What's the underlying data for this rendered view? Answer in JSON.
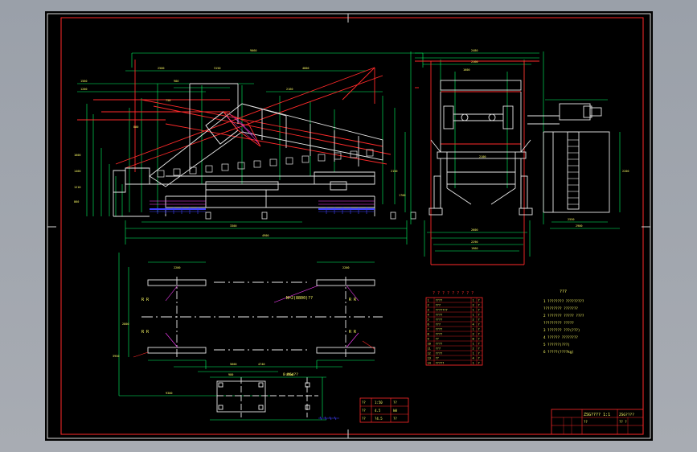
{
  "drawing": {
    "background": "#000000",
    "frame_color": "#e0e0e0",
    "border_color": "#ff2a2a",
    "dim_color": "#00ff66",
    "feature_color": "#ff2a2a",
    "aux_color": "#ff40ff",
    "hatch_color": "#4040ff",
    "text_color": "#ffff66"
  },
  "labels": {
    "plan_spacing_note": "N=2(8800)??",
    "bolt_note": "8-M64??",
    "corner_note_a": "R  R",
    "corner_note_b": "R  R",
    "corner_note_c": "R  R",
    "corner_note_d": "R  R"
  },
  "bom": {
    "header": "? ? ? ? ? ? ? ? ?",
    "rows": [
      [
        "1",
        "????",
        "1",
        "?"
      ],
      [
        "2",
        "???",
        "2",
        "?"
      ],
      [
        "3",
        "???????",
        "1",
        "?"
      ],
      [
        "4",
        "????",
        "1",
        "?"
      ],
      [
        "5",
        "????",
        "2",
        "?"
      ],
      [
        "6",
        "???",
        "4",
        "?"
      ],
      [
        "7",
        "????",
        "1",
        "?"
      ],
      [
        "8",
        "????",
        "2",
        "?"
      ],
      [
        "9",
        "??",
        "8",
        "?"
      ],
      [
        "10",
        "????",
        "1",
        "?"
      ],
      [
        "11",
        "???",
        "2",
        "?"
      ],
      [
        "12",
        "????",
        "1",
        "?"
      ],
      [
        "13",
        "??",
        "4",
        "?"
      ],
      [
        "14",
        "?????",
        "1",
        "?"
      ]
    ]
  },
  "notes": {
    "title": "???",
    "items": [
      "1  ???????? ?????????",
      "   ????????? ???????",
      "2  ??????? ????? ????",
      "   ????????? ?????",
      "3  ???????  ???(???)",
      "4  ?????? ????????",
      "5  ??????(???)",
      "6  ?????(????kg)"
    ]
  },
  "mini_table": {
    "rows": [
      [
        "??",
        "1:50",
        "??"
      ],
      [
        "??",
        "4.5",
        "kW"
      ],
      [
        "??",
        "?4.5",
        "??"
      ]
    ]
  },
  "title_block": {
    "drawing_title": "ZSG????  1:1",
    "drawing_code": "ZSG????",
    "sheet_info": "??",
    "note": "??  ?"
  }
}
